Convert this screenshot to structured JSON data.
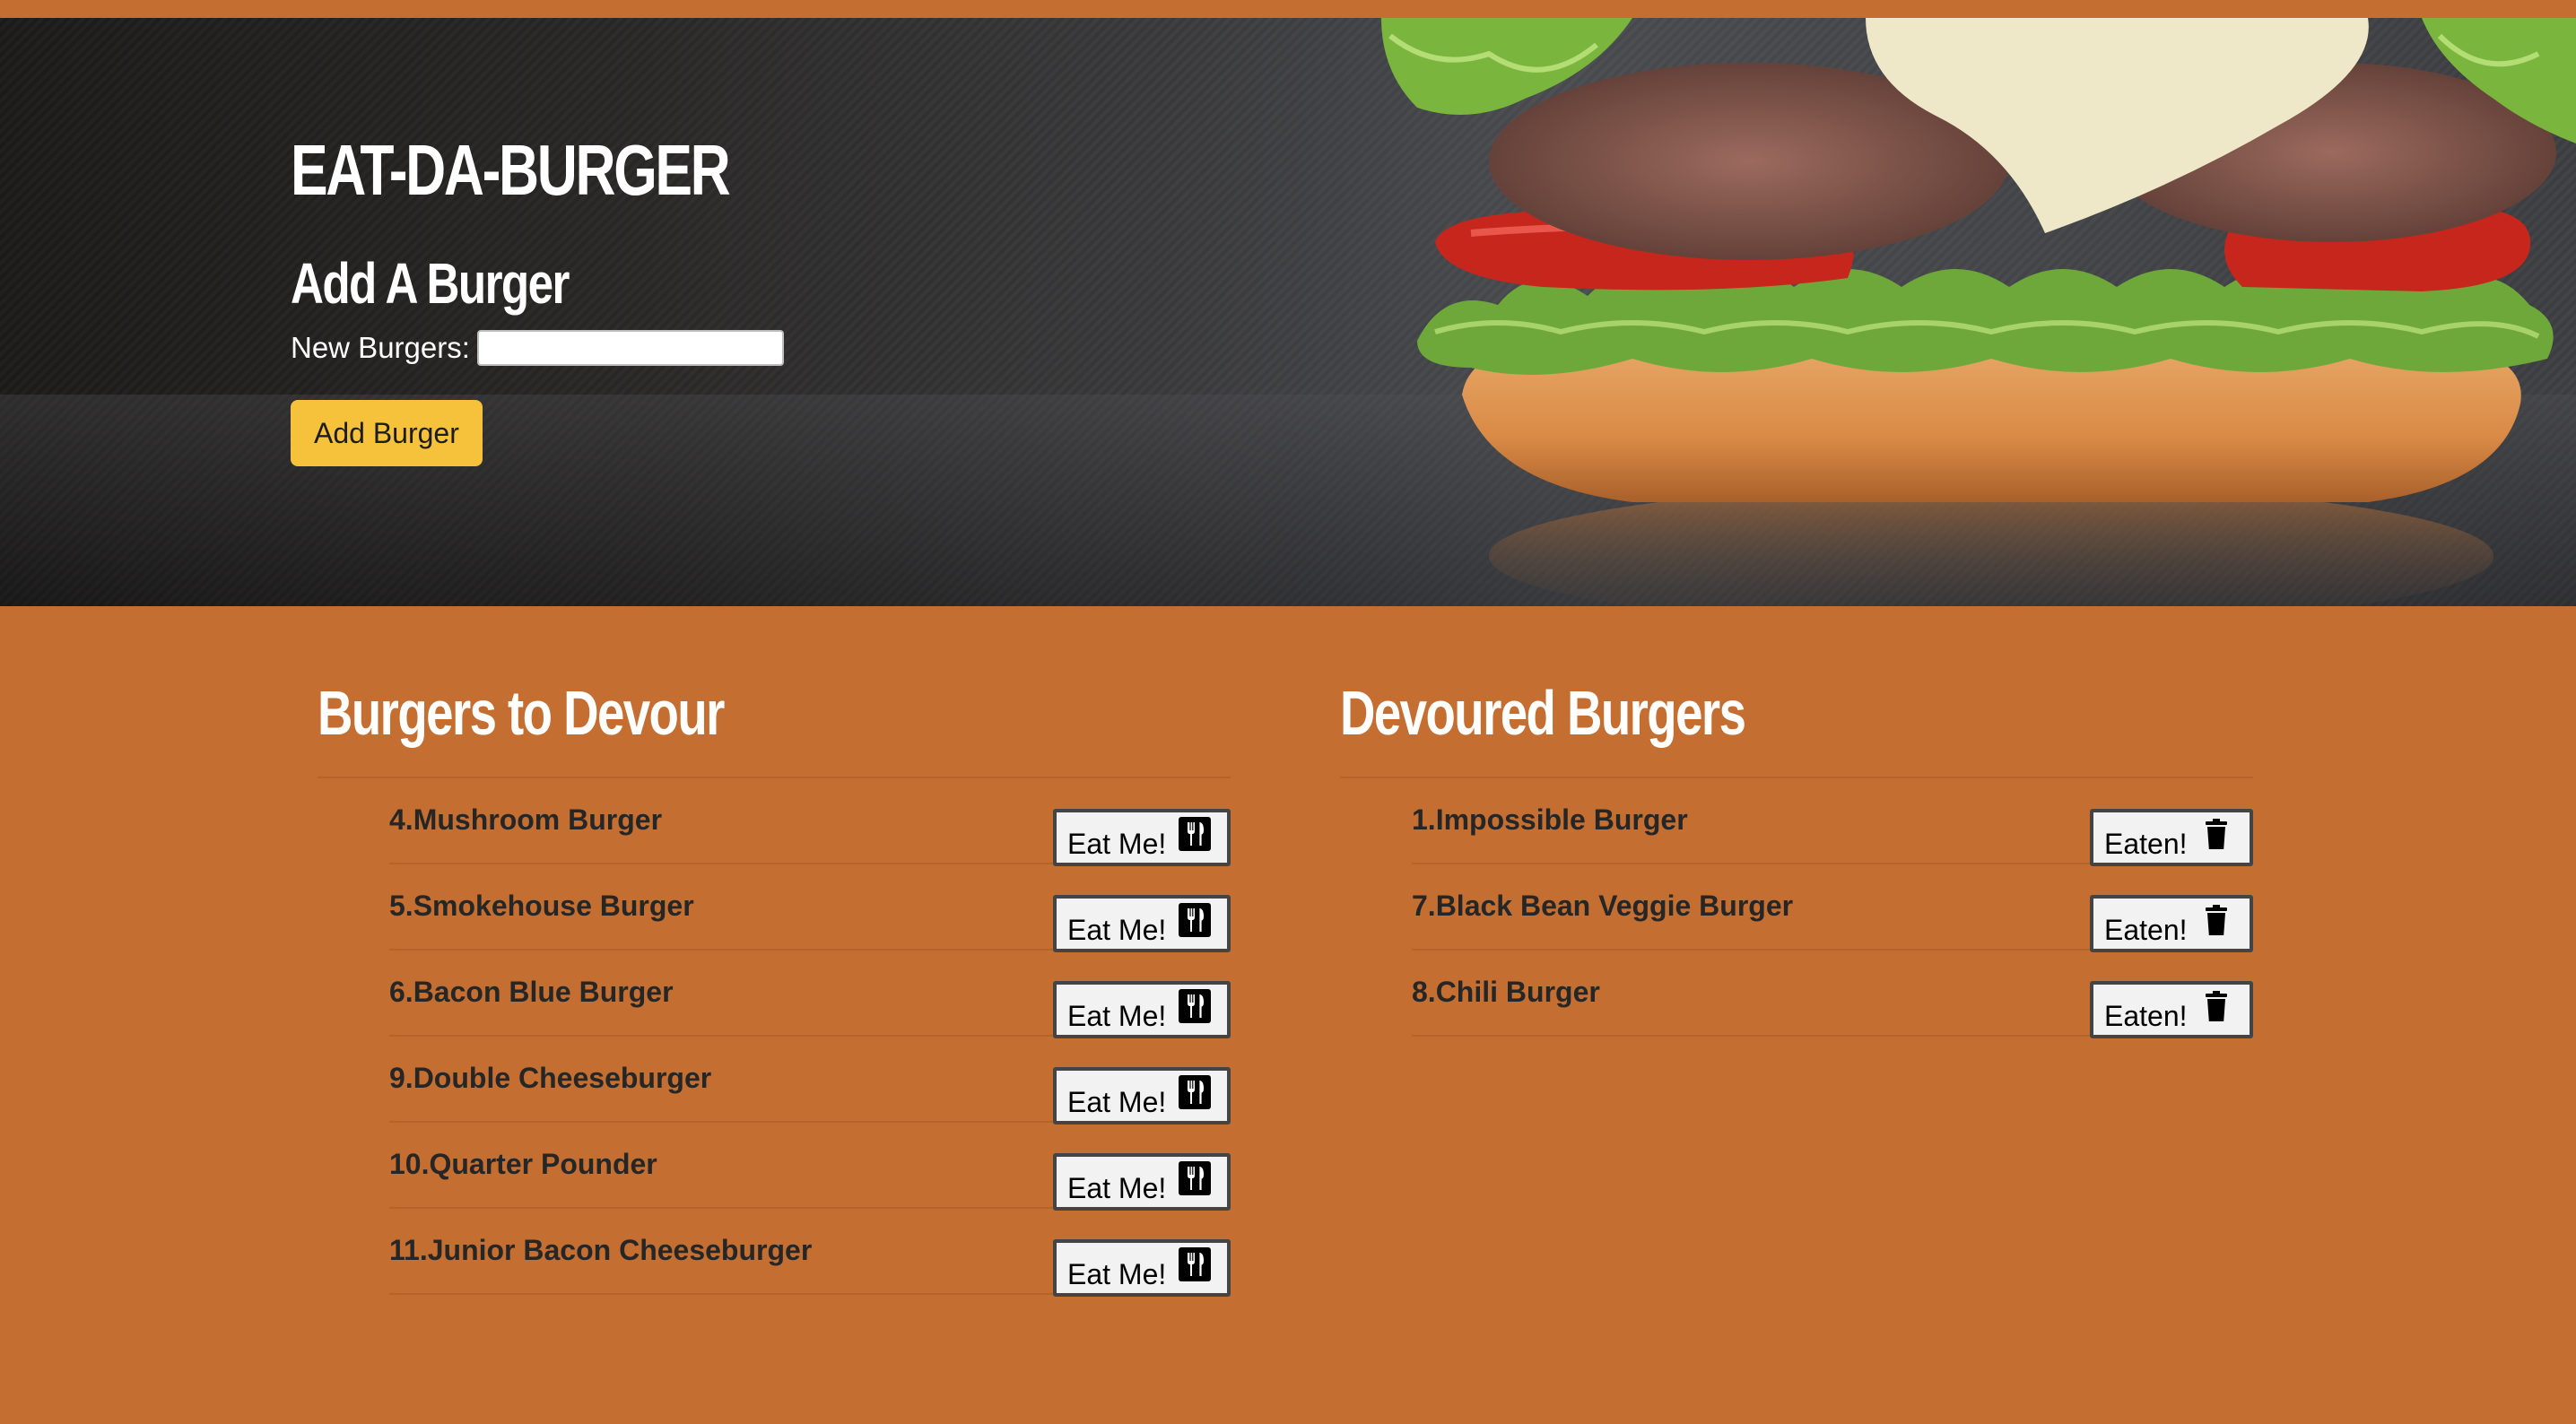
{
  "header": {
    "title": "EAT-DA-BURGER",
    "add_section_title": "Add A Burger",
    "new_burger_label": "New Burgers:",
    "new_burger_value": "",
    "add_button_label": "Add Burger"
  },
  "to_devour": {
    "title": "Burgers to Devour",
    "button_label": "Eat Me!",
    "button_icon": "utensils-icon",
    "items": [
      {
        "name": "4.Mushroom Burger"
      },
      {
        "name": "5.Smokehouse Burger"
      },
      {
        "name": "6.Bacon Blue Burger"
      },
      {
        "name": "9.Double Cheeseburger"
      },
      {
        "name": "10.Quarter Pounder"
      },
      {
        "name": "11.Junior Bacon Cheeseburger"
      }
    ]
  },
  "devoured": {
    "title": "Devoured Burgers",
    "button_label": "Eaten!",
    "button_icon": "trash-icon",
    "items": [
      {
        "name": "1.Impossible Burger"
      },
      {
        "name": "7.Black Bean Veggie Burger"
      },
      {
        "name": "8.Chili Burger"
      }
    ]
  },
  "colors": {
    "page_background": "#c46f31",
    "add_button": "#f6c13b",
    "hero_dark": "#1d1b1a"
  }
}
